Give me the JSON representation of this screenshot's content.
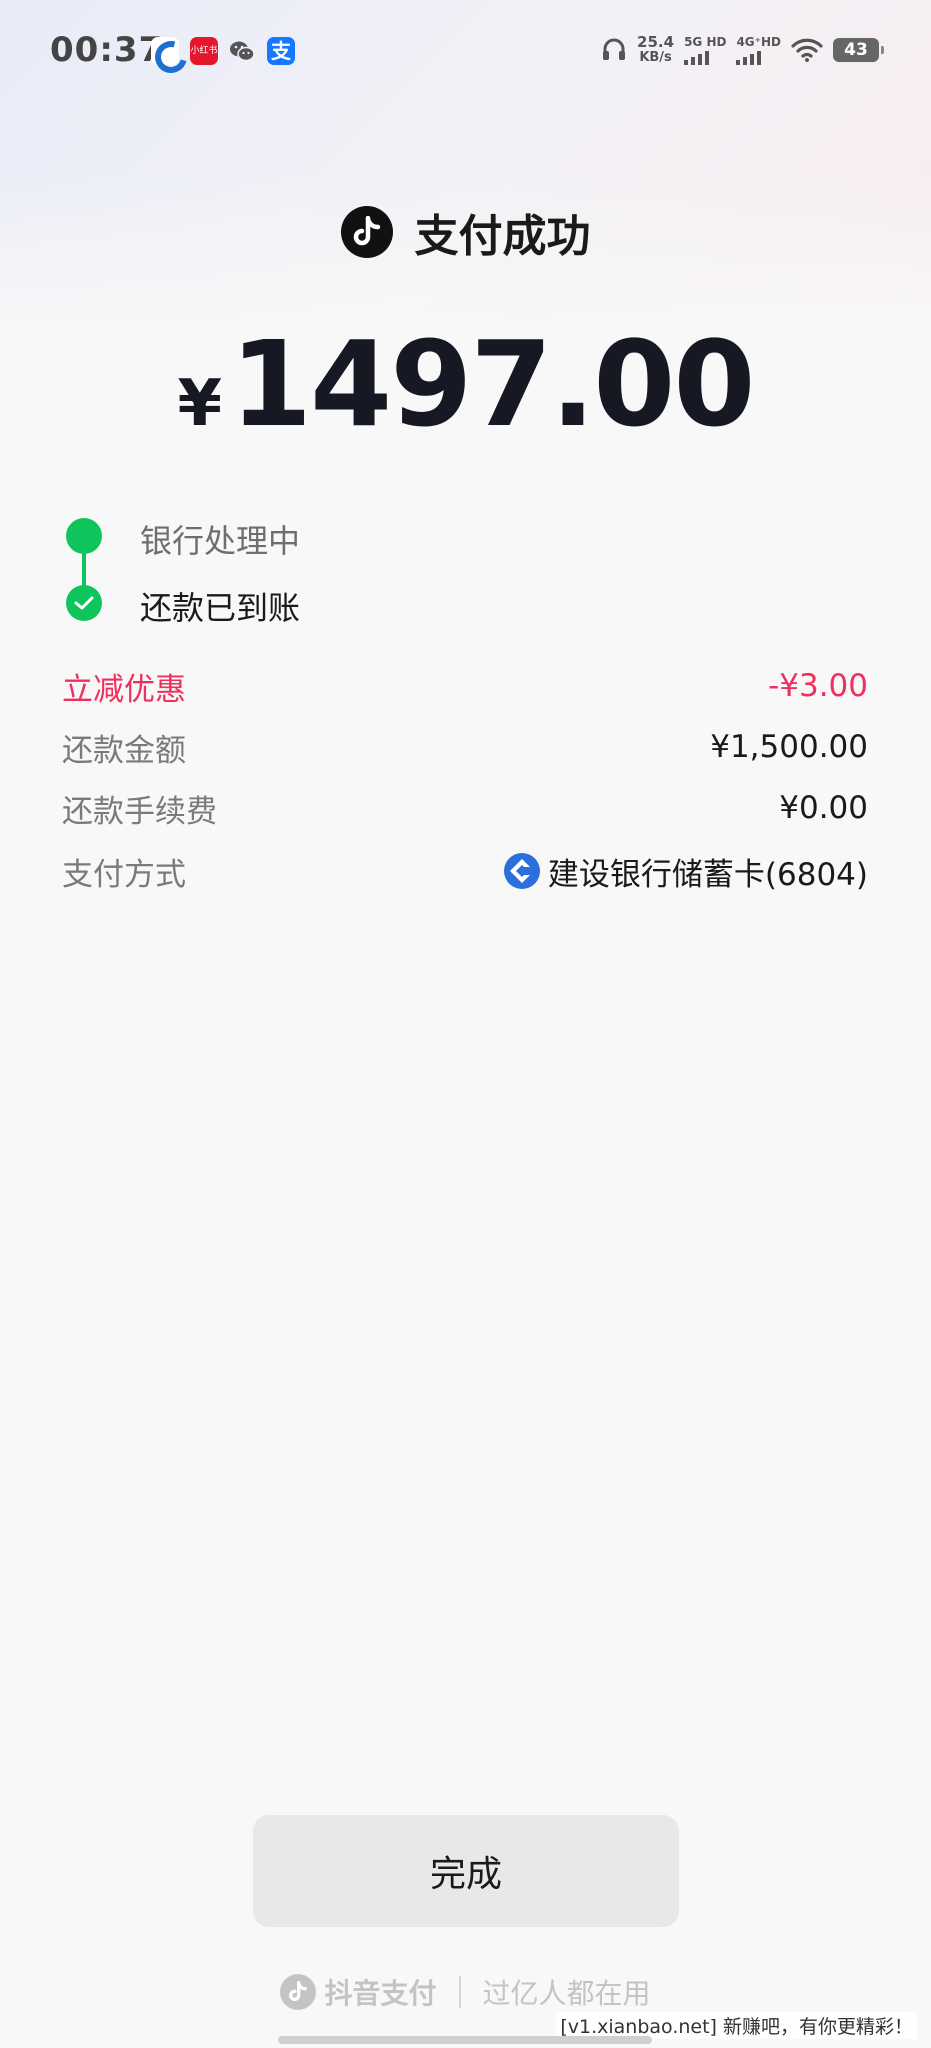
{
  "status_bar": {
    "time": "00:37",
    "app_icons": [
      "ccb-icon",
      "red-app-icon",
      "wechat-icon",
      "alipay-icon"
    ],
    "red_app_text": "小红书",
    "alipay_glyph": "支",
    "net_speed_value": "25.4",
    "net_speed_unit": "KB/s",
    "sim1_label": "5G HD",
    "sim2_label": "4G⁺HD",
    "battery": "43"
  },
  "header": {
    "title": "支付成功",
    "logo_icon": "tiktok-icon"
  },
  "amount": {
    "currency": "¥",
    "value": "1497.00"
  },
  "timeline": {
    "steps": [
      {
        "label": "银行处理中",
        "state": "done"
      },
      {
        "label": "还款已到账",
        "state": "complete"
      }
    ],
    "accent_color": "#10c45c"
  },
  "details": {
    "discount": {
      "label": "立减优惠",
      "value": "-¥3.00",
      "color": "#f0305c"
    },
    "repay_amount": {
      "label": "还款金额",
      "value": "¥1,500.00"
    },
    "fee": {
      "label": "还款手续费",
      "value": "¥0.00"
    },
    "method": {
      "label": "支付方式",
      "value": "建设银行储蓄卡(6804)",
      "icon": "ccb-bank-icon"
    }
  },
  "done_button": {
    "label": "完成"
  },
  "footer": {
    "brand": "抖音支付",
    "slogan": "过亿人都在用"
  },
  "watermark": "[v1.xianbao.net] 新赚吧，有你更精彩！"
}
